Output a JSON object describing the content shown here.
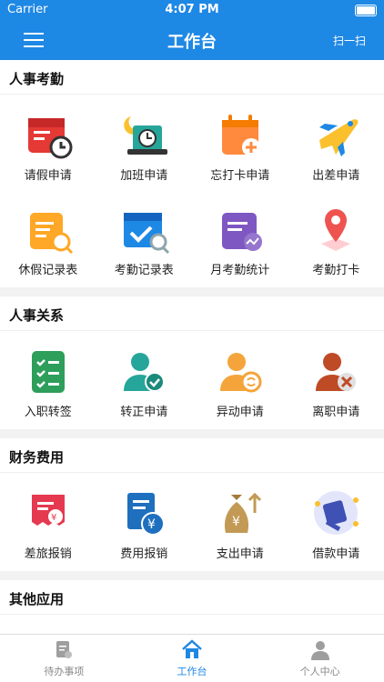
{
  "status": {
    "carrier": "Carrier",
    "time": "4:07 PM"
  },
  "nav": {
    "title": "工作台",
    "scan": "扫一扫"
  },
  "sections": [
    {
      "title": "人事考勤",
      "items": [
        {
          "label": "请假申请",
          "icon": "leave-calendar-icon"
        },
        {
          "label": "加班申请",
          "icon": "overtime-clock-icon"
        },
        {
          "label": "忘打卡申请",
          "icon": "forgot-punch-calendar-icon"
        },
        {
          "label": "出差申请",
          "icon": "airplane-icon"
        },
        {
          "label": "休假记录表",
          "icon": "vacation-record-icon"
        },
        {
          "label": "考勤记录表",
          "icon": "attendance-record-icon"
        },
        {
          "label": "月考勤统计",
          "icon": "monthly-stats-icon"
        },
        {
          "label": "考勤打卡",
          "icon": "location-pin-icon"
        }
      ]
    },
    {
      "title": "人事关系",
      "items": [
        {
          "label": "入职转签",
          "icon": "checklist-icon"
        },
        {
          "label": "转正申请",
          "icon": "user-check-icon"
        },
        {
          "label": "异动申请",
          "icon": "user-transfer-icon"
        },
        {
          "label": "离职申请",
          "icon": "user-remove-icon"
        }
      ]
    },
    {
      "title": "财务费用",
      "items": [
        {
          "label": "差旅报销",
          "icon": "travel-receipt-icon"
        },
        {
          "label": "费用报销",
          "icon": "expense-receipt-icon"
        },
        {
          "label": "支出申请",
          "icon": "money-bag-icon"
        },
        {
          "label": "借款申请",
          "icon": "loan-card-icon"
        }
      ]
    },
    {
      "title": "其他应用",
      "items": [
        {
          "label": "",
          "icon": "virus-icon"
        },
        {
          "label": "",
          "icon": "tv-play-icon"
        },
        {
          "label": "",
          "icon": "notebook-icon"
        }
      ]
    }
  ],
  "tabs": [
    {
      "label": "待办事项",
      "icon": "todo-icon",
      "active": false
    },
    {
      "label": "工作台",
      "icon": "home-icon",
      "active": true
    },
    {
      "label": "个人中心",
      "icon": "user-icon",
      "active": false
    }
  ]
}
